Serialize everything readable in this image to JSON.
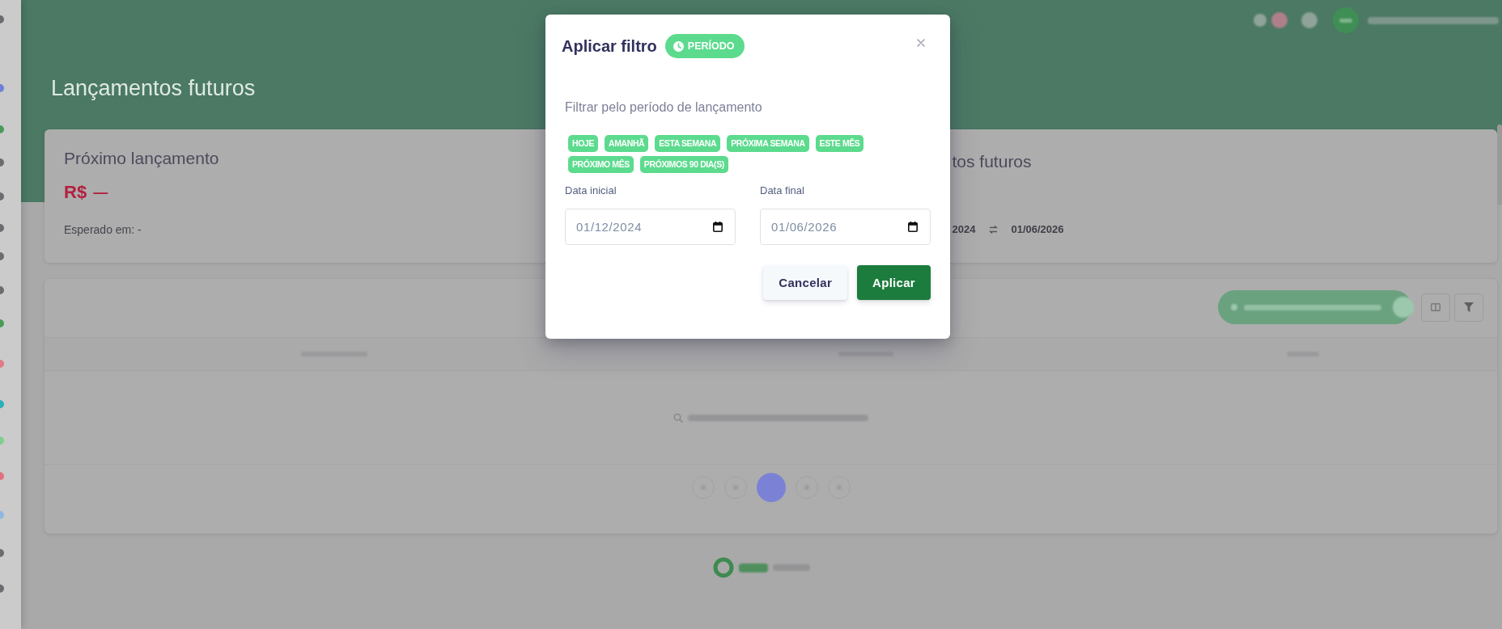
{
  "header": {
    "title": "Lançamentos futuros"
  },
  "cards": [
    {
      "kind": "next",
      "title": "Próximo lançamento",
      "currency": "R$",
      "amount": "—",
      "note": "Esperado em: -"
    },
    {
      "kind": "period",
      "title": "tos futuros",
      "date_from": "2024",
      "date_to": "01/06/2026"
    }
  ],
  "modal": {
    "title": "Aplicar filtro",
    "badge": "PERÍODO",
    "subtitle": "Filtrar pelo período de lançamento",
    "presets": [
      {
        "label": "HOJE"
      },
      {
        "label": "AMANHÃ"
      },
      {
        "label": "ESTA SEMANA"
      },
      {
        "label": "PRÓXIMA SEMANA"
      },
      {
        "label": "ESTE MÊS"
      },
      {
        "label": "PRÓXIMO MÊS"
      },
      {
        "label": "PRÓXIMOS 90 DIA(S)"
      }
    ],
    "fields": [
      {
        "label": "Data inicial",
        "value": "01/12/2024"
      },
      {
        "label": "Data final",
        "value": "01/06/2026"
      }
    ],
    "buttons": [
      {
        "label": "Cancelar",
        "kind": "secondary"
      },
      {
        "label": "Aplicar",
        "kind": "primary"
      }
    ]
  }
}
